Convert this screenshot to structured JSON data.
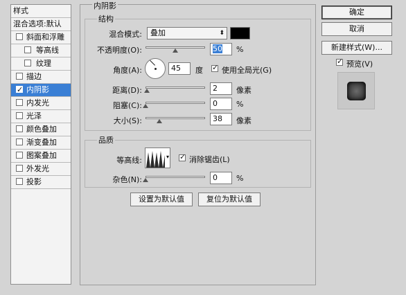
{
  "left": {
    "header": "样式",
    "blend_options": "混合选项:默认",
    "items": [
      {
        "label": "斜面和浮雕",
        "checked": false,
        "indent": false
      },
      {
        "label": "等高线",
        "checked": false,
        "indent": true
      },
      {
        "label": "纹理",
        "checked": false,
        "indent": true
      },
      {
        "label": "描边",
        "checked": false,
        "indent": false
      },
      {
        "label": "内阴影",
        "checked": true,
        "indent": false,
        "selected": true
      },
      {
        "label": "内发光",
        "checked": false,
        "indent": false
      },
      {
        "label": "光泽",
        "checked": false,
        "indent": false
      },
      {
        "label": "颜色叠加",
        "checked": false,
        "indent": false
      },
      {
        "label": "渐变叠加",
        "checked": false,
        "indent": false
      },
      {
        "label": "图案叠加",
        "checked": false,
        "indent": false
      },
      {
        "label": "外发光",
        "checked": false,
        "indent": false
      },
      {
        "label": "投影",
        "checked": false,
        "indent": false
      }
    ]
  },
  "main": {
    "section_title": "内阴影",
    "structure": {
      "title": "结构",
      "blend_mode_label": "混合模式:",
      "blend_mode_value": "叠加",
      "color": "#000000",
      "opacity_label": "不透明度(O):",
      "opacity_value": "50",
      "opacity_unit": "%",
      "angle_label": "角度(A):",
      "angle_value": "45",
      "angle_unit": "度",
      "global_light_label": "使用全局光(G)",
      "global_light_checked": true,
      "distance_label": "距离(D):",
      "distance_value": "2",
      "distance_unit": "像素",
      "choke_label": "阻塞(C):",
      "choke_value": "0",
      "choke_unit": "%",
      "size_label": "大小(S):",
      "size_value": "38",
      "size_unit": "像素"
    },
    "quality": {
      "title": "品质",
      "contour_label": "等高线:",
      "antialias_label": "消除锯齿(L)",
      "antialias_checked": true,
      "noise_label": "杂色(N):",
      "noise_value": "0",
      "noise_unit": "%"
    },
    "set_default": "设置为默认值",
    "reset_default": "复位为默认值"
  },
  "right": {
    "ok": "确定",
    "cancel": "取消",
    "new_style": "新建样式(W)...",
    "preview_label": "预览(V)",
    "preview_checked": true
  }
}
